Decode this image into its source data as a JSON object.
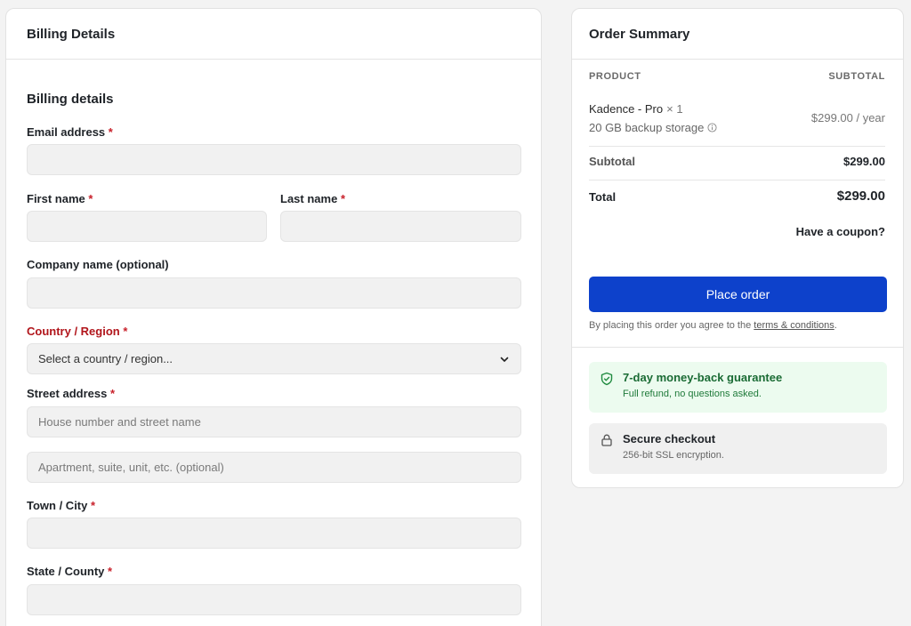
{
  "billing": {
    "card_title": "Billing Details",
    "section_title": "Billing details",
    "required_mark": "*",
    "fields": {
      "email": {
        "label": "Email address",
        "placeholder": ""
      },
      "first_name": {
        "label": "First name",
        "placeholder": ""
      },
      "last_name": {
        "label": "Last name",
        "placeholder": ""
      },
      "company": {
        "label": "Company name (optional)",
        "placeholder": ""
      },
      "country": {
        "label": "Country / Region",
        "selected": "Select a country / region..."
      },
      "street": {
        "label": "Street address",
        "placeholder1": "House number and street name",
        "placeholder2": "Apartment, suite, unit, etc. (optional)"
      },
      "city": {
        "label": "Town / City",
        "placeholder": ""
      },
      "state": {
        "label": "State / County",
        "placeholder": ""
      }
    }
  },
  "summary": {
    "card_title": "Order Summary",
    "col_product": "PRODUCT",
    "col_subtotal": "SUBTOTAL",
    "product": {
      "name": "Kadence - Pro",
      "qty": "× 1",
      "addon": "20 GB backup storage",
      "price": "$299.00 / year"
    },
    "subtotal_label": "Subtotal",
    "subtotal_value": "$299.00",
    "total_label": "Total",
    "total_value": "$299.00",
    "coupon": "Have a coupon?",
    "place_order": "Place order",
    "terms_prefix": "By placing this order you agree to the ",
    "terms_link": "terms & conditions",
    "terms_suffix": ".",
    "guarantee": {
      "title": "7-day money-back guarantee",
      "text": "Full refund, no questions asked."
    },
    "secure": {
      "title": "Secure checkout",
      "text": "256-bit SSL encryption."
    }
  },
  "colors": {
    "accent": "#0d41cb",
    "error": "#b1151b",
    "success_bg": "#ecfbef",
    "success_text": "#1a6b34"
  },
  "icons": {
    "chevron": "chevron-down-icon",
    "info": "info-icon",
    "shield": "shield-check-icon",
    "lock": "lock-icon"
  }
}
